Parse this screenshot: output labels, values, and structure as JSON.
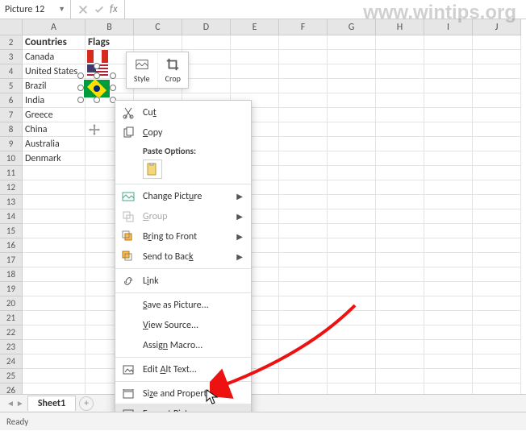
{
  "watermark": "www.wintips.org",
  "namebox": "Picture 12",
  "fx_symbol": "fx",
  "columns": [
    "A",
    "B",
    "C",
    "D",
    "E",
    "F",
    "G",
    "H",
    "I",
    "J"
  ],
  "row_numbers": [
    2,
    3,
    4,
    5,
    6,
    7,
    8,
    9,
    10,
    11,
    12,
    13,
    14,
    15,
    16,
    17,
    18,
    19,
    20,
    21,
    22,
    23,
    24,
    25,
    26
  ],
  "headers": {
    "A": "Countries",
    "B": "Flags"
  },
  "countries": [
    "Canada",
    "United States",
    "Brazil",
    "India",
    "Greece",
    "China",
    "Australia",
    "Denmark"
  ],
  "mini_toolbar": {
    "style": "Style",
    "crop": "Crop"
  },
  "context_menu": {
    "cut": "Cut",
    "copy": "Copy",
    "paste_options": "Paste Options:",
    "change_picture": "Change Picture",
    "group": "Group",
    "bring_to_front": "Bring to Front",
    "send_to_back": "Send to Back",
    "link": "Link",
    "save_as_picture": "Save as Picture...",
    "view_source": "View Source...",
    "assign_macro": "Assign Macro...",
    "edit_alt_text": "Edit Alt Text...",
    "size_and_properties": "Size and Properties...",
    "format_picture": "Format Picture..."
  },
  "sheet_tab": "Sheet1",
  "status": "Ready"
}
